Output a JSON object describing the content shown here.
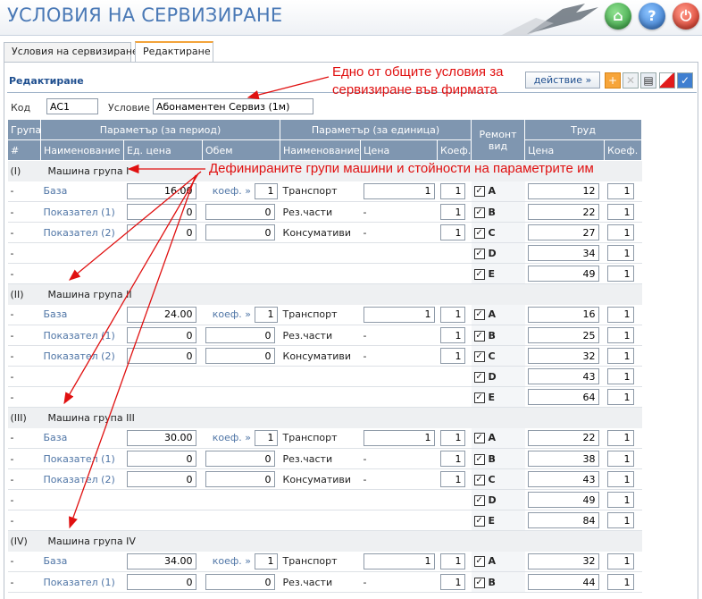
{
  "app": {
    "title": "УСЛОВИЯ НА СЕРВИЗИРАНЕ"
  },
  "header_buttons": [
    {
      "icon": "home-icon"
    },
    {
      "icon": "help-icon",
      "glyph": "?"
    },
    {
      "icon": "power-icon"
    }
  ],
  "tabs": [
    {
      "label": "Условия на сервизиране",
      "active": false
    },
    {
      "label": "Редактиране",
      "active": true
    }
  ],
  "section": {
    "title": "Редактиране"
  },
  "toolbar": {
    "action_label": "действие »"
  },
  "form": {
    "code_label": "Код",
    "code_value": "AC1",
    "cond_label": "Условие",
    "cond_value": "Абонаментен Сервиз (1м)"
  },
  "table": {
    "h1": {
      "group": "Група",
      "period": "Параметър (за период)",
      "unit": "Параметър (за единица)",
      "repair": "Ремонт вид",
      "labor": "Труд"
    },
    "h2": {
      "num": "#",
      "name": "Наименование",
      "unit_price": "Ед. цена",
      "volume": "Обем",
      "name2": "Наименование",
      "price": "Цена",
      "coef": "Коеф.",
      "labor_price": "Цена",
      "labor_coef": "Коеф."
    },
    "koef_label": "коеф. »",
    "groups": [
      {
        "num": "(I)",
        "name": "Машина група I",
        "rows": [
          {
            "dash": "-",
            "p_name": "База",
            "p_price": "16.00",
            "p_vol": "1",
            "u_name": "Транспорт",
            "u_price": "1",
            "u_coef": "1",
            "r_type": "A",
            "l_price": "12",
            "l_coef": "1"
          },
          {
            "dash": "-",
            "p_name": "Показател (1)",
            "p_price": "0",
            "p_vol": "0",
            "u_name": "Рез.части",
            "u_price": "-",
            "u_coef": "1",
            "r_type": "B",
            "l_price": "22",
            "l_coef": "1"
          },
          {
            "dash": "-",
            "p_name": "Показател (2)",
            "p_price": "0",
            "p_vol": "0",
            "u_name": "Консумативи",
            "u_price": "-",
            "u_coef": "1",
            "r_type": "C",
            "l_price": "27",
            "l_coef": "1"
          },
          {
            "dash": "-",
            "r_type": "D",
            "l_price": "34",
            "l_coef": "1"
          },
          {
            "dash": "-",
            "r_type": "E",
            "l_price": "49",
            "l_coef": "1"
          }
        ]
      },
      {
        "num": "(II)",
        "name": "Машина група II",
        "rows": [
          {
            "dash": "-",
            "p_name": "База",
            "p_price": "24.00",
            "p_vol": "1",
            "u_name": "Транспорт",
            "u_price": "1",
            "u_coef": "1",
            "r_type": "A",
            "l_price": "16",
            "l_coef": "1"
          },
          {
            "dash": "-",
            "p_name": "Показател (1)",
            "p_price": "0",
            "p_vol": "0",
            "u_name": "Рез.части",
            "u_price": "-",
            "u_coef": "1",
            "r_type": "B",
            "l_price": "25",
            "l_coef": "1"
          },
          {
            "dash": "-",
            "p_name": "Показател (2)",
            "p_price": "0",
            "p_vol": "0",
            "u_name": "Консумативи",
            "u_price": "-",
            "u_coef": "1",
            "r_type": "C",
            "l_price": "32",
            "l_coef": "1"
          },
          {
            "dash": "-",
            "r_type": "D",
            "l_price": "43",
            "l_coef": "1"
          },
          {
            "dash": "-",
            "r_type": "E",
            "l_price": "64",
            "l_coef": "1"
          }
        ]
      },
      {
        "num": "(III)",
        "name": "Машина група III",
        "rows": [
          {
            "dash": "-",
            "p_name": "База",
            "p_price": "30.00",
            "p_vol": "1",
            "u_name": "Транспорт",
            "u_price": "1",
            "u_coef": "1",
            "r_type": "A",
            "l_price": "22",
            "l_coef": "1"
          },
          {
            "dash": "-",
            "p_name": "Показател (1)",
            "p_price": "0",
            "p_vol": "0",
            "u_name": "Рез.части",
            "u_price": "-",
            "u_coef": "1",
            "r_type": "B",
            "l_price": "38",
            "l_coef": "1"
          },
          {
            "dash": "-",
            "p_name": "Показател (2)",
            "p_price": "0",
            "p_vol": "0",
            "u_name": "Консумативи",
            "u_price": "-",
            "u_coef": "1",
            "r_type": "C",
            "l_price": "43",
            "l_coef": "1"
          },
          {
            "dash": "-",
            "r_type": "D",
            "l_price": "49",
            "l_coef": "1"
          },
          {
            "dash": "-",
            "r_type": "E",
            "l_price": "84",
            "l_coef": "1"
          }
        ]
      },
      {
        "num": "(IV)",
        "name": "Машина група IV",
        "rows": [
          {
            "dash": "-",
            "p_name": "База",
            "p_price": "34.00",
            "p_vol": "1",
            "u_name": "Транспорт",
            "u_price": "1",
            "u_coef": "1",
            "r_type": "A",
            "l_price": "32",
            "l_coef": "1"
          },
          {
            "dash": "-",
            "p_name": "Показател (1)",
            "p_price": "0",
            "p_vol": "0",
            "u_name": "Рез.части",
            "u_price": "-",
            "u_coef": "1",
            "r_type": "B",
            "l_price": "44",
            "l_coef": "1"
          }
        ]
      }
    ]
  },
  "annotations": {
    "callout1_line1": "Едно от общите условия за",
    "callout1_line2": "сервизиране във фирмата",
    "callout2": "Дефинираните групи машини и стойности на параметрите им",
    "color": "#e01010"
  }
}
